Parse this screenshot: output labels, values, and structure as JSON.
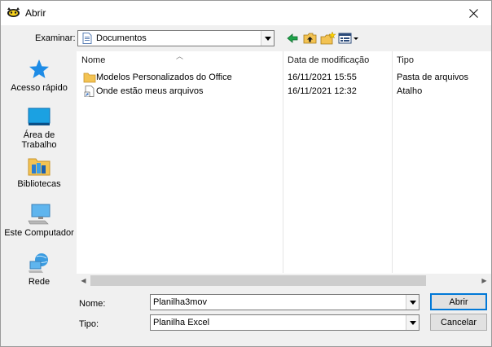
{
  "window": {
    "title": "Abrir"
  },
  "lookin": {
    "label": "Examinar:",
    "value": "Documentos"
  },
  "toolbar": {
    "icons": [
      "back-arrow-icon",
      "up-folder-icon",
      "new-folder-icon",
      "view-menu-icon"
    ]
  },
  "places": [
    {
      "label": "Acesso rápido",
      "icon": "star-icon"
    },
    {
      "label": "Área de Trabalho",
      "icon": "desktop-icon"
    },
    {
      "label": "Bibliotecas",
      "icon": "libraries-folder-icon"
    },
    {
      "label": "Este Computador",
      "icon": "computer-icon"
    },
    {
      "label": "Rede",
      "icon": "network-icon"
    }
  ],
  "columns": {
    "name": "Nome",
    "date": "Data de modificação",
    "type": "Tipo"
  },
  "files": [
    {
      "name": "Modelos Personalizados do Office",
      "date": "16/11/2021 15:55",
      "type": "Pasta de arquivos",
      "icon": "folder-icon"
    },
    {
      "name": "Onde estão meus arquivos",
      "date": "16/11/2021 12:32",
      "type": "Atalho",
      "icon": "shortcut-icon"
    }
  ],
  "filename": {
    "label": "Nome:",
    "value": "Planilha3mov"
  },
  "filetype": {
    "label": "Tipo:",
    "value": "Planilha Excel"
  },
  "buttons": {
    "open": "Abrir",
    "cancel": "Cancelar"
  },
  "colors": {
    "accent": "#0078d7",
    "folder": "#f3c353",
    "selection_border": "#0078d7"
  }
}
